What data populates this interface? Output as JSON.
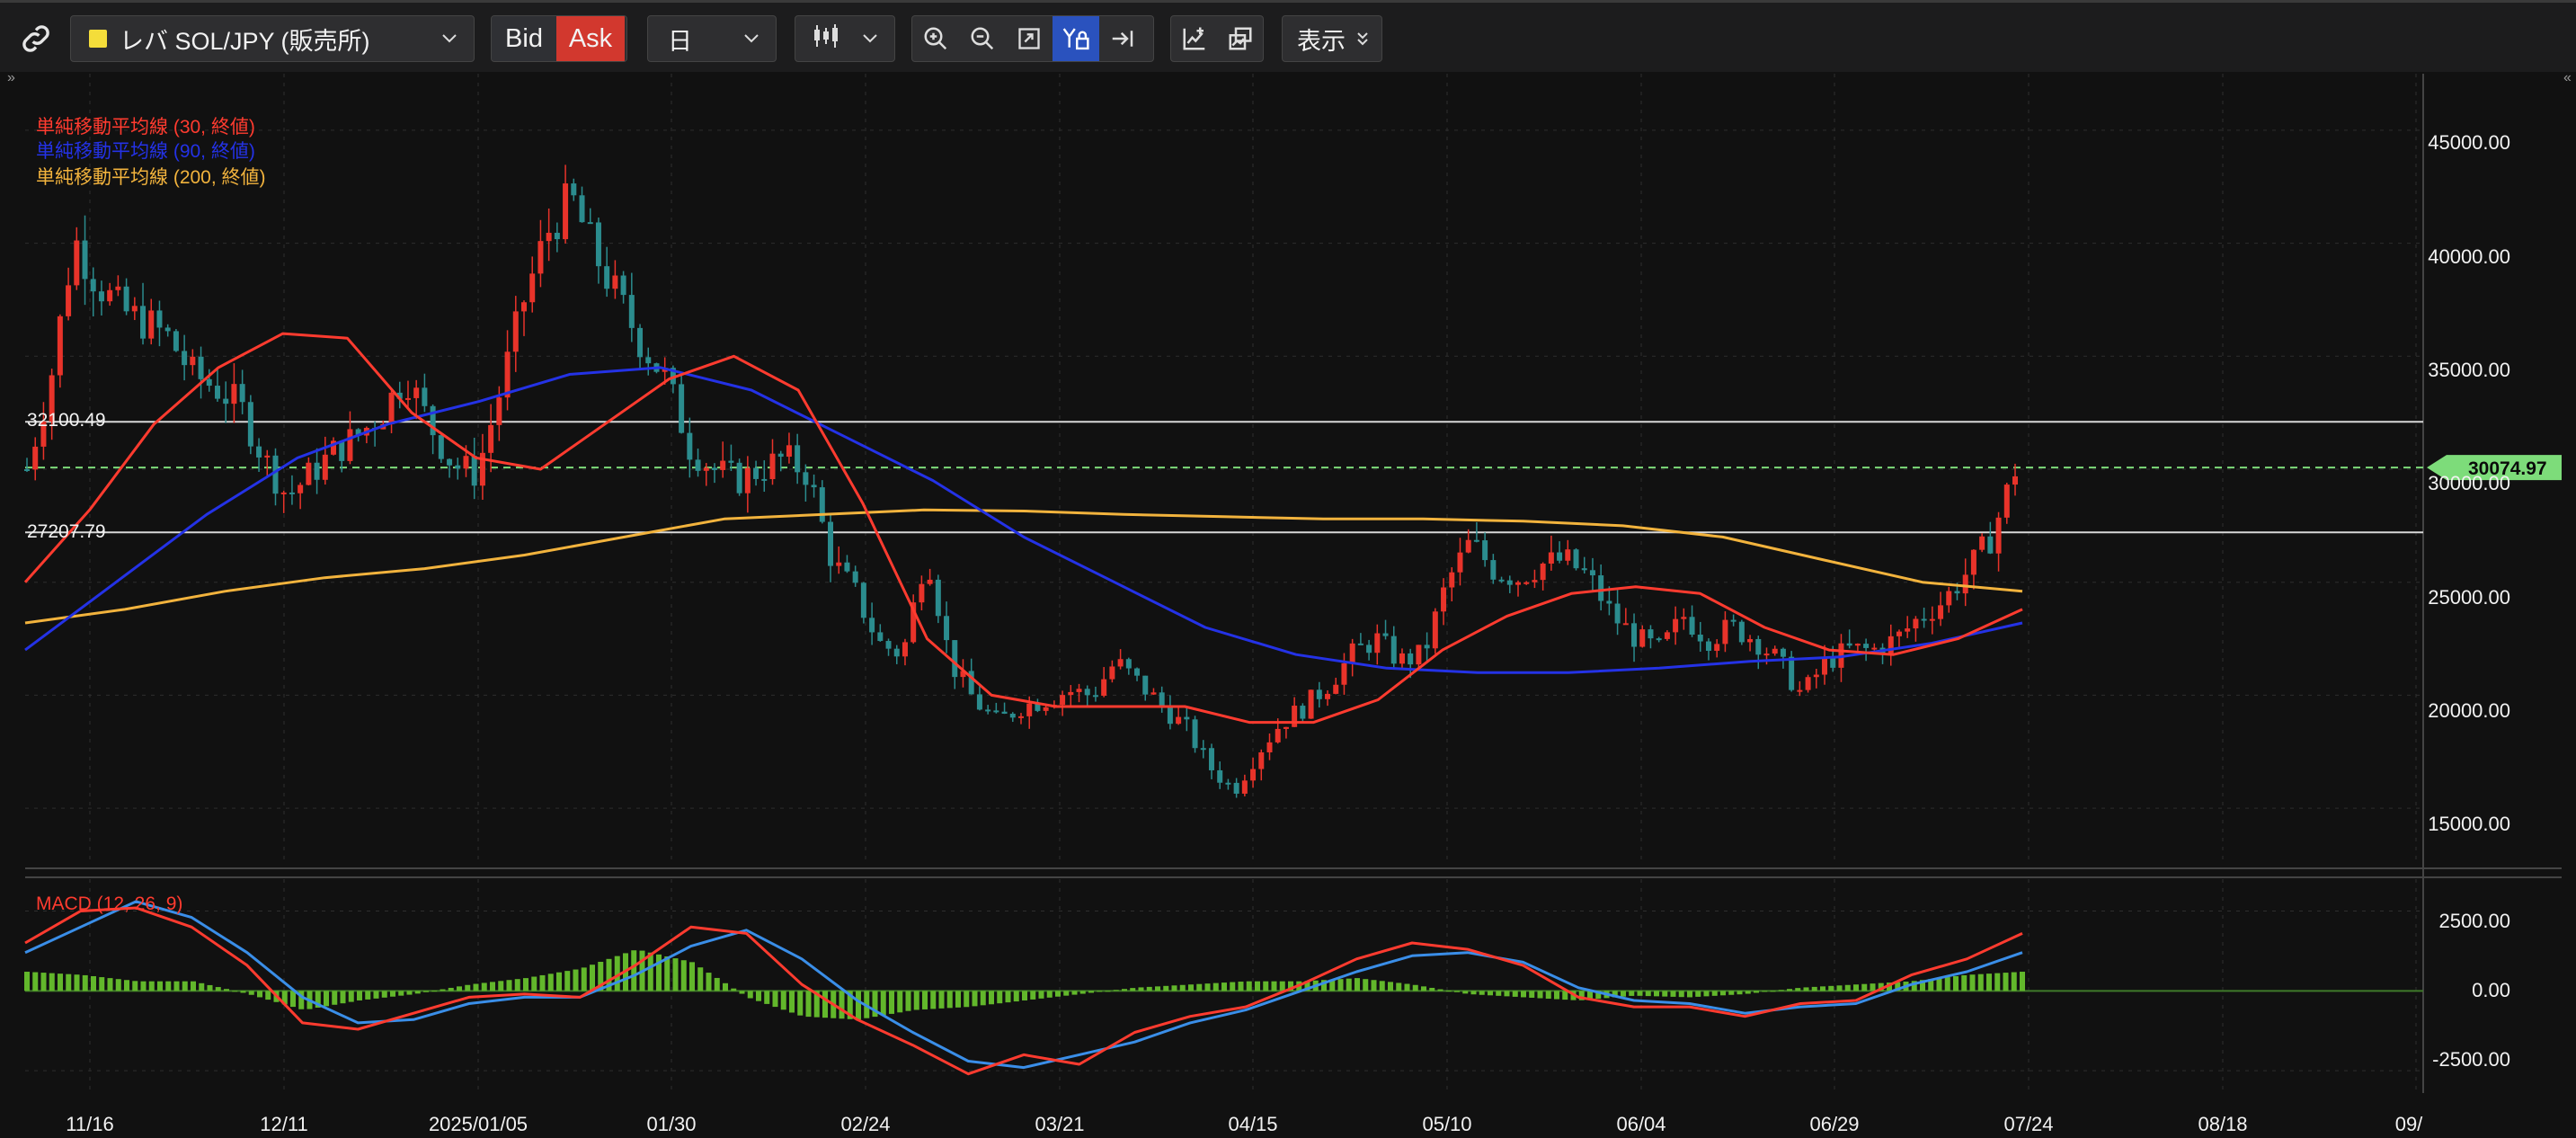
{
  "toolbar": {
    "symbol": "レバ SOL/JPY (販売所)",
    "bid_label": "Bid",
    "ask_label": "Ask",
    "timeframe": "日",
    "display_label": "表示"
  },
  "colors": {
    "up": "#e8332a",
    "down": "#2b8c8e",
    "sma30": "#ff3b2f",
    "sma90": "#2432e6",
    "sma200": "#f2b33d",
    "macd": "#ff3b2f",
    "signal": "#3a8ee8",
    "hist": "#62b72b",
    "price_tag": "#7ddc7a"
  },
  "chart_data": [
    {
      "type": "candlestick",
      "x_labels": [
        "11/16",
        "12/11",
        "2025/01/05",
        "01/30",
        "02/24",
        "03/21",
        "04/15",
        "05/10",
        "06/04",
        "06/29",
        "07/24",
        "08/18",
        "09/"
      ],
      "ylim": [
        12500,
        47500
      ],
      "y_ticks": [
        "45000.00",
        "40000.00",
        "35000.00",
        "30000.00",
        "25000.00",
        "20000.00",
        "15000.00"
      ],
      "legend": [
        "単純移動平均線 (30, 終値)",
        "単純移動平均線 (90, 終値)",
        "単純移動平均線 (200, 終値)"
      ],
      "hlines": [
        {
          "label": "32100.49",
          "value": 32100.49
        },
        {
          "label": "27207.79",
          "value": 27207.79
        }
      ],
      "current_price": {
        "label": "30074.97",
        "value": 30074.97
      },
      "ohlc_series": [
        30000,
        34000,
        40200,
        38200,
        37000,
        36500,
        35800,
        34200,
        33600,
        32800,
        30500,
        28800,
        29800,
        30800,
        31500,
        32500,
        34200,
        32000,
        30200,
        29800,
        33500,
        37500,
        40500,
        42000,
        39500,
        37500,
        35500,
        34000,
        31000,
        30000,
        29500,
        30000,
        30500,
        29800,
        26000,
        24500,
        22300,
        21800,
        26500,
        21500,
        19800,
        18800,
        19500,
        19800,
        20200,
        20000,
        21500,
        20500,
        19500,
        18500,
        16800,
        15800,
        17500,
        18800,
        19500,
        20500,
        21800,
        22500,
        21500,
        21800,
        25000,
        26800,
        25500,
        25200,
        25800,
        26000,
        25200,
        23500,
        22500,
        22000,
        23500,
        22500,
        23000,
        22500,
        21500,
        20000,
        21500,
        22000,
        22000,
        22500,
        23500,
        24200,
        25500,
        27000,
        30000
      ],
      "sma30_series": [
        25000,
        28200,
        32000,
        34500,
        36000,
        35800,
        32500,
        30500,
        30000,
        32000,
        34000,
        35000,
        33500,
        28500,
        22500,
        20000,
        19500,
        19500,
        19500,
        18800,
        18800,
        19800,
        22000,
        23500,
        24500,
        24800,
        24500,
        23000,
        22000,
        21800,
        22500,
        23800
      ],
      "sma90_series": [
        22000,
        25000,
        28000,
        30500,
        32000,
        33000,
        34200,
        34500,
        33500,
        31500,
        29500,
        27000,
        25000,
        23000,
        21800,
        21200,
        21000,
        21000,
        21200,
        21500,
        21700,
        22300,
        23200
      ],
      "sma200_series": [
        23200,
        23800,
        24600,
        25200,
        25600,
        26200,
        27000,
        27800,
        28000,
        28200,
        28150,
        28000,
        27900,
        27800,
        27800,
        27700,
        27500,
        27000,
        26000,
        25000,
        24600
      ],
      "series": [
        {
          "name": "単純移動平均線 (30, 終値)"
        },
        {
          "name": "単純移動平均線 (90, 終値)"
        },
        {
          "name": "単純移動平均線 (200, 終値)"
        }
      ]
    },
    {
      "type": "bar",
      "legend": [
        "MACD (12, 26, 9)"
      ],
      "ylim": [
        -3200,
        3500
      ],
      "y_ticks": [
        "2500.00",
        "0.00",
        "-2500.00"
      ],
      "macd_series": [
        1500,
        2500,
        2600,
        2000,
        800,
        -1000,
        -1200,
        -700,
        -200,
        -100,
        -200,
        800,
        2000,
        1800,
        200,
        -900,
        -1700,
        -2600,
        -2000,
        -2300,
        -1300,
        -800,
        -500,
        200,
        1000,
        1500,
        1300,
        800,
        -200,
        -500,
        -500,
        -800,
        -400,
        -300,
        500,
        1000,
        1800
      ],
      "signal_series": [
        1200,
        2000,
        2800,
        2300,
        1200,
        -200,
        -1000,
        -900,
        -400,
        -200,
        -200,
        500,
        1400,
        1900,
        1000,
        -300,
        -1300,
        -2200,
        -2400,
        -2000,
        -1600,
        -1000,
        -600,
        0,
        600,
        1100,
        1200,
        900,
        100,
        -300,
        -400,
        -700,
        -500,
        -400,
        200,
        600,
        1200
      ],
      "histogram_series": [
        600,
        500,
        300,
        300,
        -100,
        -600,
        -300,
        -100,
        200,
        400,
        700,
        1300,
        900,
        -200,
        -800,
        -900,
        -600,
        -500,
        -300,
        -100,
        100,
        200,
        300,
        300,
        400,
        200,
        -100,
        -200,
        -300,
        -150,
        -200,
        -100,
        100,
        200,
        300,
        500,
        600
      ]
    }
  ]
}
